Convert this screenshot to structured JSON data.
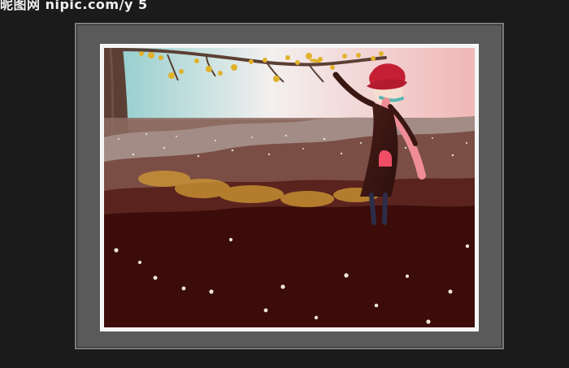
{
  "watermark": {
    "text": "昵图网 nipic.com/y 5"
  },
  "scene": {
    "sky_top": "#7fc6c2",
    "sky_pink": "#f1b7b7",
    "ground_dark": "#3b0c09",
    "tree_brown": "#5b3f34",
    "leaf_yellow": "#e0b12a",
    "hat_red": "#c51f34",
    "coat_dark": "#3a1713",
    "scarf_pink": "#ef8d96",
    "scarf_teal": "#5ab7b6",
    "flower_cream": "#efe5d9"
  }
}
